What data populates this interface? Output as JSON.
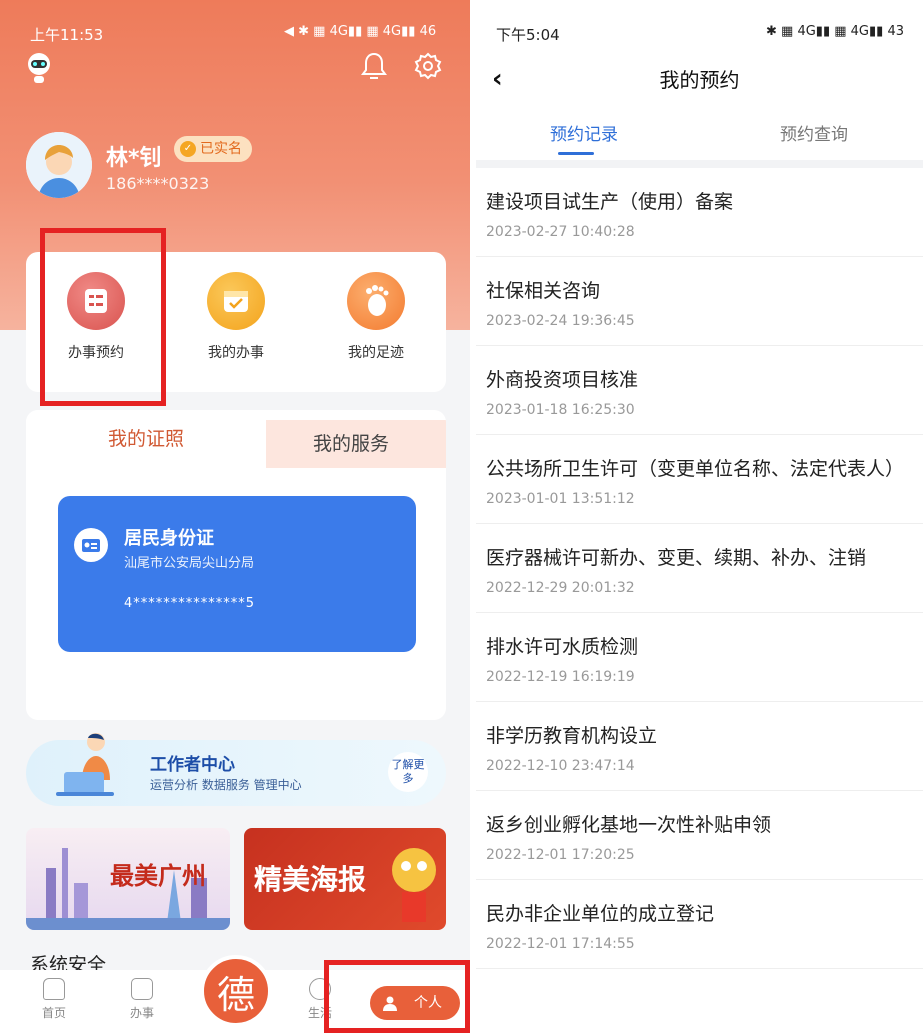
{
  "left": {
    "status_bar": {
      "time": "上午11:53",
      "battery": "46"
    },
    "user": {
      "name": "林*钊",
      "verified": "已实名",
      "phone": "186****0323"
    },
    "quick_actions": [
      {
        "label": "办事预约",
        "icon": "appointment-icon"
      },
      {
        "label": "我的办事",
        "icon": "calendar-icon"
      },
      {
        "label": "我的足迹",
        "icon": "footprint-icon"
      }
    ],
    "tabs": {
      "certificates": "我的证照",
      "services": "我的服务"
    },
    "id_card": {
      "title": "居民身份证",
      "issuer": "汕尾市公安局尖山分局",
      "number": "4***************5"
    },
    "worker_center": {
      "title": "工作者中心",
      "subtitle": "运营分析  数据服务  管理中心",
      "more": "了解更多"
    },
    "banners": {
      "guangzhou": "最美广州",
      "poster": "精美海报"
    },
    "section_title": "系统安全",
    "tabbar": {
      "home": "首页",
      "tasks": "办事",
      "center": "德",
      "life": "生活",
      "personal": "个人"
    }
  },
  "right": {
    "status_bar": {
      "time": "下午5:04",
      "battery": "43"
    },
    "title": "我的预约",
    "tabs": {
      "records": "预约记录",
      "query": "预约查询"
    },
    "appointments": [
      {
        "name": "建设项目试生产（使用）备案",
        "date": "2023-02-27 10:40:28"
      },
      {
        "name": "社保相关咨询",
        "date": "2023-02-24 19:36:45"
      },
      {
        "name": "外商投资项目核准",
        "date": "2023-01-18 16:25:30"
      },
      {
        "name": "公共场所卫生许可（变更单位名称、法定代表人）",
        "date": "2023-01-01 13:51:12"
      },
      {
        "name": "医疗器械许可新办、变更、续期、补办、注销",
        "date": "2022-12-29 20:01:32"
      },
      {
        "name": "排水许可水质检测",
        "date": "2022-12-19 16:19:19"
      },
      {
        "name": "非学历教育机构设立",
        "date": "2022-12-10 23:47:14"
      },
      {
        "name": "返乡创业孵化基地一次性补贴申领",
        "date": "2022-12-01 17:20:25"
      },
      {
        "name": "民办非企业单位的成立登记",
        "date": "2022-12-01 17:14:55"
      }
    ]
  }
}
